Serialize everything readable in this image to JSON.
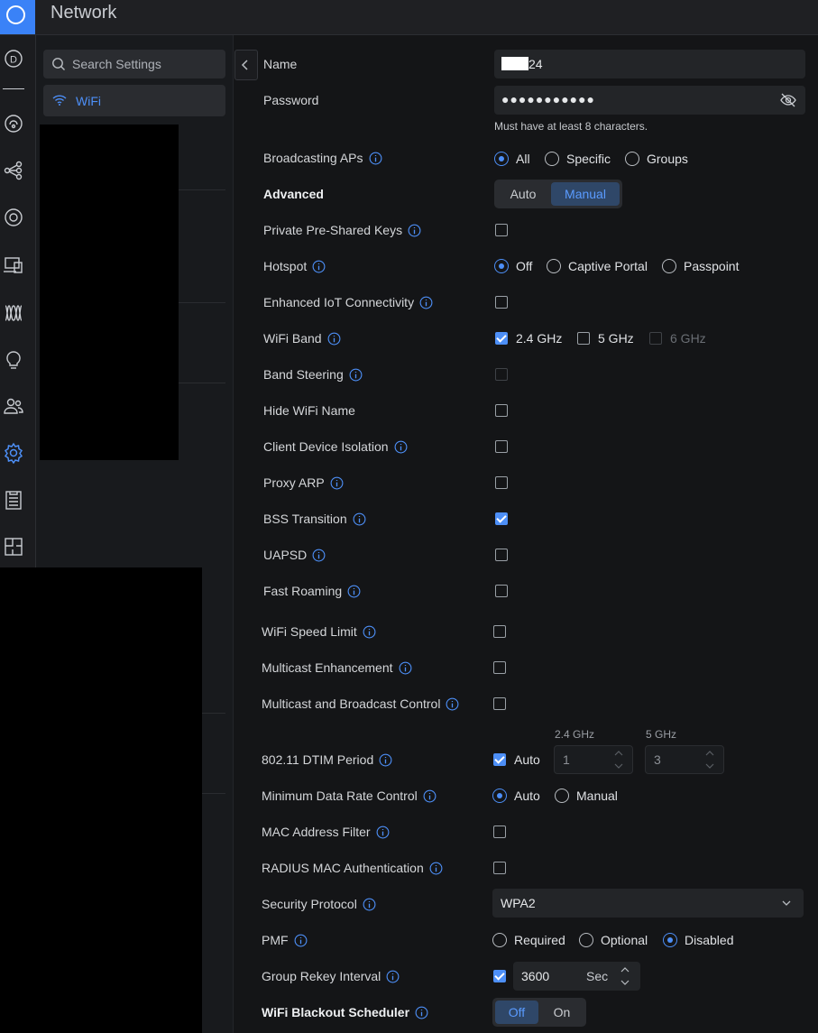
{
  "header": {
    "title": "Network"
  },
  "sidebar": {
    "search_placeholder": "Search Settings",
    "items": [
      {
        "label": "WiFi",
        "icon": "wifi-icon"
      }
    ]
  },
  "rail": {
    "items": [
      "dashboard-icon",
      "topology-icon",
      "devices-icon",
      "clients-icon",
      "ports-icon",
      "insights-icon",
      "alarm-icon",
      "users-icon",
      "settings-icon",
      "logs-icon",
      "floorplan-icon"
    ]
  },
  "form": {
    "name": {
      "label": "Name",
      "value": "24"
    },
    "password": {
      "label": "Password",
      "value": "●●●●●●●●●●●",
      "hint": "Must have at least 8 characters."
    },
    "broadcasting_aps": {
      "label": "Broadcasting APs",
      "options": [
        "All",
        "Specific",
        "Groups"
      ],
      "selected": "All"
    },
    "advanced": {
      "label": "Advanced",
      "options": [
        "Auto",
        "Manual"
      ],
      "selected": "Manual"
    },
    "private_psk": {
      "label": "Private Pre-Shared Keys",
      "checked": false
    },
    "hotspot": {
      "label": "Hotspot",
      "options": [
        "Off",
        "Captive Portal",
        "Passpoint"
      ],
      "selected": "Off"
    },
    "iot": {
      "label": "Enhanced IoT Connectivity",
      "checked": false
    },
    "wifi_band": {
      "label": "WiFi Band",
      "options": [
        {
          "label": "2.4 GHz",
          "checked": true,
          "disabled": false
        },
        {
          "label": "5 GHz",
          "checked": false,
          "disabled": false
        },
        {
          "label": "6 GHz",
          "checked": false,
          "disabled": true
        }
      ]
    },
    "band_steering": {
      "label": "Band Steering",
      "checked": false,
      "disabled": true
    },
    "hide_name": {
      "label": "Hide WiFi Name",
      "checked": false
    },
    "client_isolation": {
      "label": "Client Device Isolation",
      "checked": false
    },
    "proxy_arp": {
      "label": "Proxy ARP",
      "checked": false
    },
    "bss_transition": {
      "label": "BSS Transition",
      "checked": true
    },
    "uapsd": {
      "label": "UAPSD",
      "checked": false
    },
    "fast_roaming": {
      "label": "Fast Roaming",
      "checked": false
    },
    "speed_limit": {
      "label": "WiFi Speed Limit",
      "checked": false
    },
    "multicast_enh": {
      "label": "Multicast Enhancement",
      "checked": false
    },
    "multicast_ctrl": {
      "label": "Multicast and Broadcast Control",
      "checked": false
    },
    "dtim": {
      "label": "802.11 DTIM Period",
      "auto_label": "Auto",
      "auto": true,
      "band1": "2.4 GHz",
      "band1_value": "1",
      "band2": "5 GHz",
      "band2_value": "3"
    },
    "min_rate": {
      "label": "Minimum Data Rate Control",
      "options": [
        "Auto",
        "Manual"
      ],
      "selected": "Auto"
    },
    "mac_filter": {
      "label": "MAC Address Filter",
      "checked": false
    },
    "radius_mac": {
      "label": "RADIUS MAC Authentication",
      "checked": false
    },
    "security": {
      "label": "Security Protocol",
      "value": "WPA2"
    },
    "pmf": {
      "label": "PMF",
      "options": [
        "Required",
        "Optional",
        "Disabled"
      ],
      "selected": "Disabled"
    },
    "rekey": {
      "label": "Group Rekey Interval",
      "checked": true,
      "value": "3600",
      "unit": "Sec"
    },
    "blackout": {
      "label": "WiFi Blackout Scheduler",
      "options": [
        "Off",
        "On"
      ],
      "selected": "Off"
    }
  },
  "colors": {
    "accent": "#4d8ff7",
    "background": "#141517",
    "panel": "#232528"
  }
}
